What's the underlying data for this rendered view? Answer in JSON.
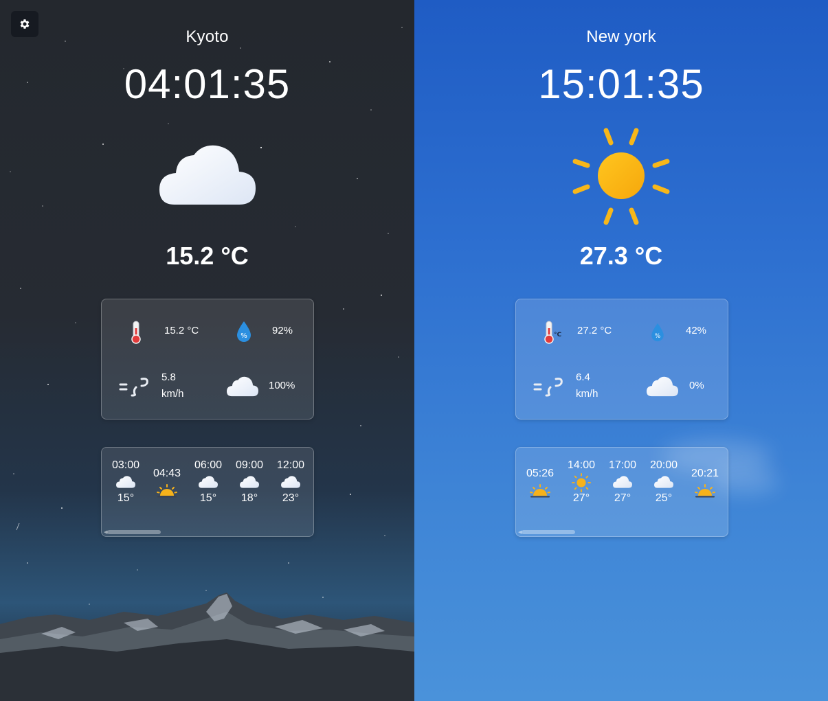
{
  "settings": {
    "icon": "gear-icon"
  },
  "left": {
    "city": "Kyoto",
    "time": "04:01:35",
    "condition_icon": "cloud-icon",
    "temperature": "15.2 °C",
    "stats": {
      "feels_like": "15.2 °C",
      "humidity": "92%",
      "wind_value": "5.8",
      "wind_unit": "km/h",
      "cloud_cover": "100%"
    },
    "hourly": [
      {
        "time": "03:00",
        "icon": "cloud-icon",
        "temp": "15°"
      },
      {
        "time": "04:43",
        "icon": "sunrise-icon",
        "temp": ""
      },
      {
        "time": "06:00",
        "icon": "cloud-icon",
        "temp": "15°"
      },
      {
        "time": "09:00",
        "icon": "cloud-icon",
        "temp": "18°"
      },
      {
        "time": "12:00",
        "icon": "cloud-icon",
        "temp": "23°"
      }
    ],
    "colors": {
      "background": "#252a31"
    }
  },
  "right": {
    "city": "New york",
    "time": "15:01:35",
    "condition_icon": "sun-icon",
    "temperature": "27.3 °C",
    "stats": {
      "feels_like": "27.2 °C",
      "humidity": "42%",
      "wind_value": "6.4",
      "wind_unit": "km/h",
      "cloud_cover": "0%"
    },
    "hourly": [
      {
        "time": "05:26",
        "icon": "sunrise-icon",
        "temp": ""
      },
      {
        "time": "14:00",
        "icon": "sun-icon",
        "temp": "27°"
      },
      {
        "time": "17:00",
        "icon": "cloud-icon",
        "temp": "27°"
      },
      {
        "time": "20:00",
        "icon": "cloud-icon",
        "temp": "25°"
      },
      {
        "time": "20:21",
        "icon": "sunset-icon",
        "temp": ""
      }
    ],
    "colors": {
      "background": "#2d6fd0"
    }
  }
}
